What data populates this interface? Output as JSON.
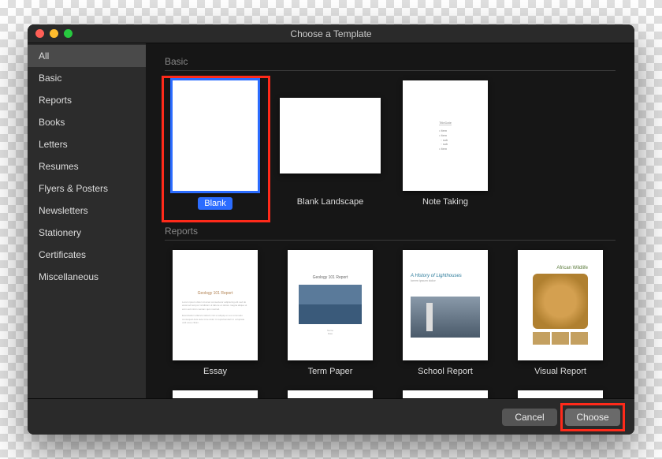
{
  "window": {
    "title": "Choose a Template"
  },
  "sidebar": {
    "items": [
      {
        "label": "All",
        "selected": true
      },
      {
        "label": "Basic"
      },
      {
        "label": "Reports"
      },
      {
        "label": "Books"
      },
      {
        "label": "Letters"
      },
      {
        "label": "Resumes"
      },
      {
        "label": "Flyers & Posters"
      },
      {
        "label": "Newsletters"
      },
      {
        "label": "Stationery"
      },
      {
        "label": "Certificates"
      },
      {
        "label": "Miscellaneous"
      }
    ]
  },
  "sections": {
    "basic": {
      "title": "Basic",
      "templates": [
        {
          "label": "Blank",
          "selected": true
        },
        {
          "label": "Blank Landscape"
        },
        {
          "label": "Note Taking"
        }
      ]
    },
    "reports": {
      "title": "Reports",
      "templates": [
        {
          "label": "Essay"
        },
        {
          "label": "Term Paper"
        },
        {
          "label": "School Report"
        },
        {
          "label": "Visual Report"
        }
      ]
    }
  },
  "thumbs": {
    "term_paper_title": "Geology 101 Report",
    "school_report_title": "A History of Lighthouses",
    "visual_report_title": "African Wildlife"
  },
  "footer": {
    "cancel": "Cancel",
    "choose": "Choose"
  },
  "highlights": {
    "blank_template": true,
    "choose_button": true
  }
}
